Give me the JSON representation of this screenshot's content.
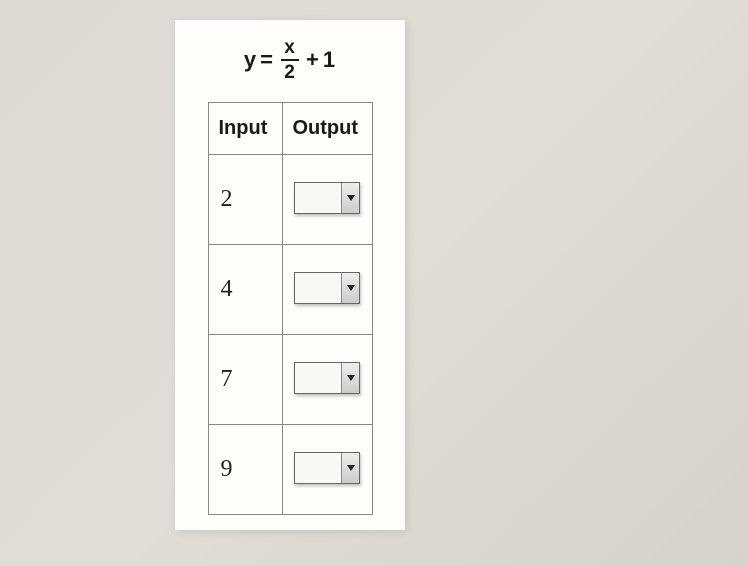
{
  "equation": {
    "lhs": "y",
    "eq": "=",
    "numerator": "x",
    "denominator": "2",
    "plus": "+",
    "constant": "1"
  },
  "table": {
    "headers": {
      "input": "Input",
      "output": "Output"
    },
    "rows": [
      {
        "input": "2",
        "output": ""
      },
      {
        "input": "4",
        "output": ""
      },
      {
        "input": "7",
        "output": ""
      },
      {
        "input": "9",
        "output": ""
      }
    ]
  }
}
